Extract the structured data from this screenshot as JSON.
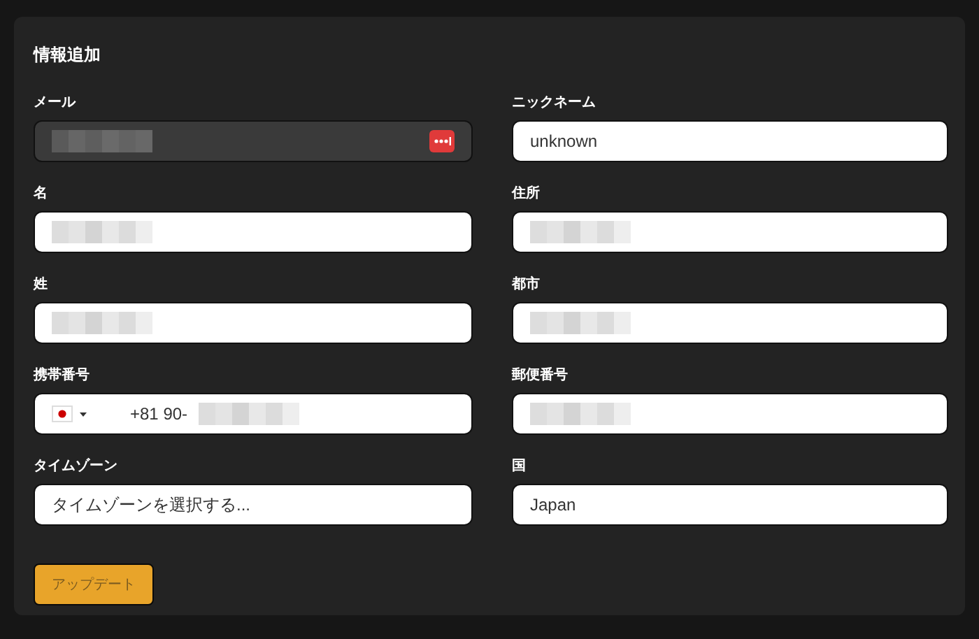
{
  "title": "情報追加",
  "fields": [
    {
      "label": "メール",
      "kind": "text",
      "disabled": true,
      "redacted": true,
      "autofill_icon": true
    },
    {
      "label": "ニックネーム",
      "kind": "text",
      "disabled": false,
      "value": "unknown"
    },
    {
      "label": "名",
      "kind": "text",
      "disabled": false,
      "redacted": true
    },
    {
      "label": "住所",
      "kind": "text",
      "disabled": false,
      "redacted": true
    },
    {
      "label": "姓",
      "kind": "text",
      "disabled": false,
      "redacted": true
    },
    {
      "label": "都市",
      "kind": "text",
      "disabled": false,
      "redacted": true
    },
    {
      "label": "携帯番号",
      "kind": "phone",
      "disabled": false,
      "value": "+81 90-",
      "redacted": true
    },
    {
      "label": "郵便番号",
      "kind": "text",
      "disabled": false,
      "redacted": true
    },
    {
      "label": "タイムゾーン",
      "kind": "select",
      "disabled": false,
      "value": "タイムゾーンを選択する..."
    },
    {
      "label": "国",
      "kind": "text",
      "disabled": false,
      "value": "Japan"
    }
  ],
  "button": "アップデート"
}
